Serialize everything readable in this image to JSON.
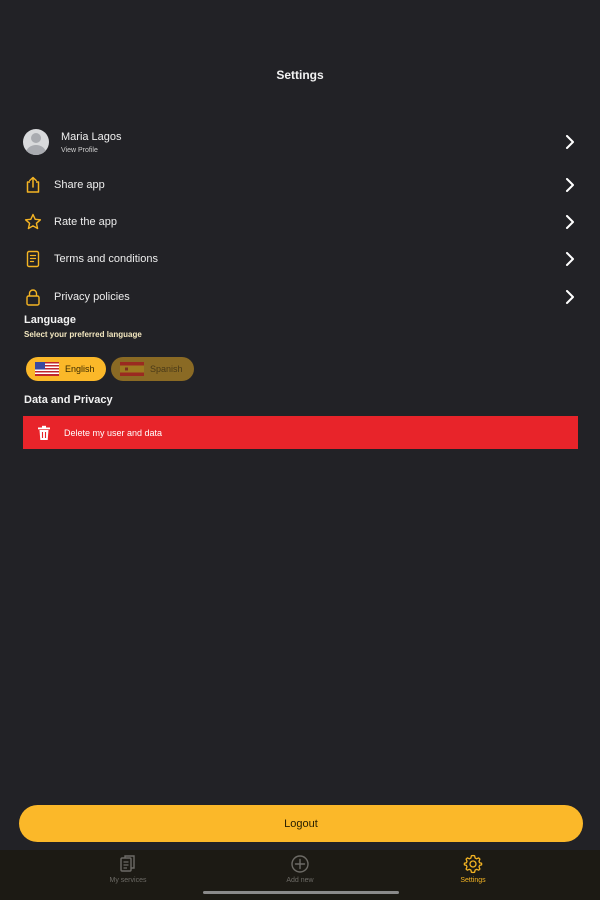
{
  "header": {
    "title": "Settings"
  },
  "profile": {
    "name": "Maria Lagos",
    "subtitle": "View Profile",
    "icon": "avatar-icon"
  },
  "menu": [
    {
      "label": "Share app",
      "icon": "share-icon"
    },
    {
      "label": "Rate the app",
      "icon": "star-icon"
    },
    {
      "label": "Terms and conditions",
      "icon": "document-icon"
    },
    {
      "label": "Privacy policies",
      "icon": "lock-icon"
    }
  ],
  "language": {
    "title": "Language",
    "subtitle": "Select your preferred language",
    "options": [
      {
        "label": "English",
        "flag": "us-flag-icon",
        "selected": true
      },
      {
        "label": "Spanish",
        "flag": "spain-flag-icon",
        "selected": false
      }
    ]
  },
  "data_privacy": {
    "title": "Data and Privacy",
    "delete_label": "Delete my user and data",
    "delete_icon": "trash-icon"
  },
  "logout": {
    "label": "Logout"
  },
  "tabs": [
    {
      "label": "My services",
      "icon": "documents-icon",
      "active": false
    },
    {
      "label": "Add new",
      "icon": "plus-circle-icon",
      "active": false
    },
    {
      "label": "Settings",
      "icon": "gear-icon",
      "active": true
    }
  ],
  "colors": {
    "background": "#222226",
    "accent": "#fbb829",
    "danger": "#e8242a",
    "tabbar": "#1c1a14"
  }
}
